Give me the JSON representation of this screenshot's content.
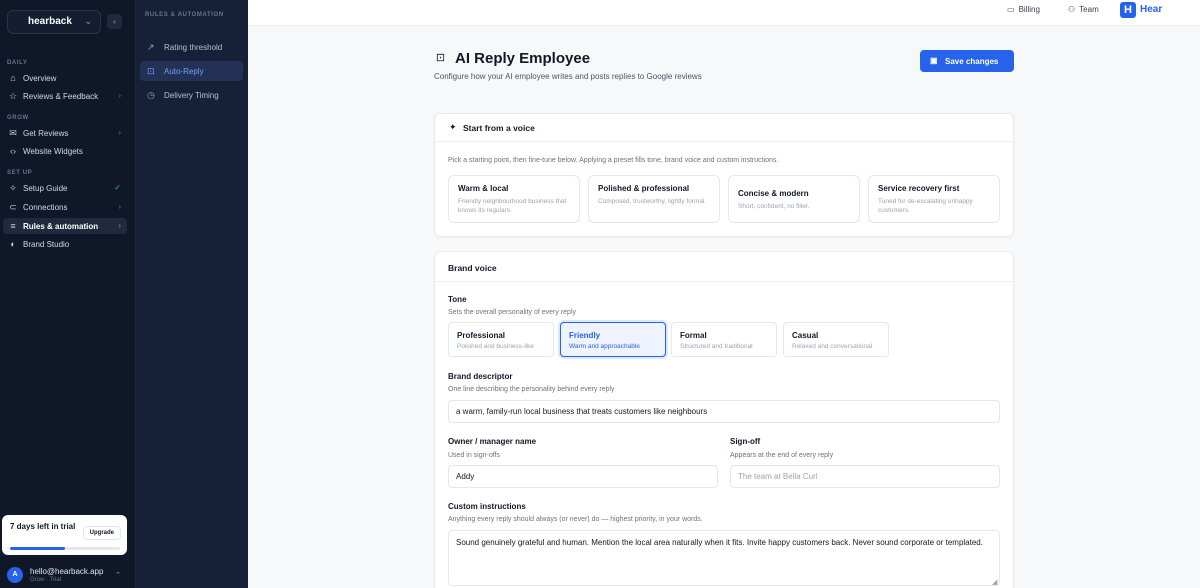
{
  "sidebar": {
    "brand": "hearback",
    "sections": {
      "daily": "DAILY",
      "grow": "GROW",
      "setup": "SET UP"
    },
    "items": [
      {
        "label": "Overview"
      },
      {
        "label": "Reviews & Feedback"
      },
      {
        "label": "Get Reviews"
      },
      {
        "label": "Website Widgets"
      },
      {
        "label": "Setup Guide"
      },
      {
        "label": "Connections"
      },
      {
        "label": "Rules & automation"
      },
      {
        "label": "Brand Studio"
      }
    ],
    "trial": {
      "text": "7 days left in trial",
      "upgrade": "Upgrade",
      "progress": 0.5
    },
    "user": {
      "avatar": "A",
      "email": "hello@hearback.app",
      "plan": "Grow · Trial"
    }
  },
  "subnav": {
    "title": "RULES & AUTOMATION",
    "items": [
      {
        "label": "Rating threshold"
      },
      {
        "label": "Auto-Reply"
      },
      {
        "label": "Delivery Timing"
      }
    ]
  },
  "topbar": {
    "billing": "Billing",
    "team": "Team",
    "logo": "H",
    "logo_text": "Hear"
  },
  "header": {
    "title": "AI Reply Employee",
    "subtitle": "Configure how your AI employee writes and posts replies to Google reviews",
    "save_label": "Save changes"
  },
  "voice_card": {
    "title": "Start from a voice",
    "hint": "Pick a starting point, then fine-tune below. Applying a preset fills tone, brand voice and custom instructions.",
    "presets": [
      {
        "title": "Warm & local",
        "desc": "Friendly neighbourhood business that knows its regulars."
      },
      {
        "title": "Polished & professional",
        "desc": "Composed, trustworthy, lightly formal."
      },
      {
        "title": "Concise & modern",
        "desc": "Short, confident, no filler."
      },
      {
        "title": "Service recovery first",
        "desc": "Tuned for de-escalating unhappy customers."
      }
    ]
  },
  "brand_card": {
    "title": "Brand voice",
    "tone_label": "Tone",
    "tone_hint": "Sets the overall personality of every reply",
    "tones": [
      {
        "title": "Professional",
        "desc": "Polished and business-like"
      },
      {
        "title": "Friendly",
        "desc": "Warm and approachable"
      },
      {
        "title": "Formal",
        "desc": "Structured and traditional"
      },
      {
        "title": "Casual",
        "desc": "Relaxed and conversational"
      }
    ],
    "selected_tone": "Friendly",
    "descriptor_label": "Brand descriptor",
    "descriptor_hint": "One line describing the personality behind every reply",
    "descriptor_value": "a warm, family-run local business that treats customers like neighbours",
    "owner_label": "Owner / manager name",
    "owner_hint": "Used in sign-offs",
    "owner_value": "Addy",
    "signoff_label": "Sign-off",
    "signoff_hint": "Appears at the end of every reply",
    "signoff_placeholder": "The team at Bella Curl",
    "custom_label": "Custom instructions",
    "custom_hint": "Anything every reply should always (or never) do — highest priority, in your words.",
    "custom_value": "Sound genuinely grateful and human. Mention the local area naturally when it fits. Invite happy customers back. Never sound corporate or templated."
  },
  "colors": {
    "accent": "#2563eb",
    "sidebar_bg": "#0f1729",
    "subnav_bg": "#162036",
    "success": "#22c55e"
  }
}
